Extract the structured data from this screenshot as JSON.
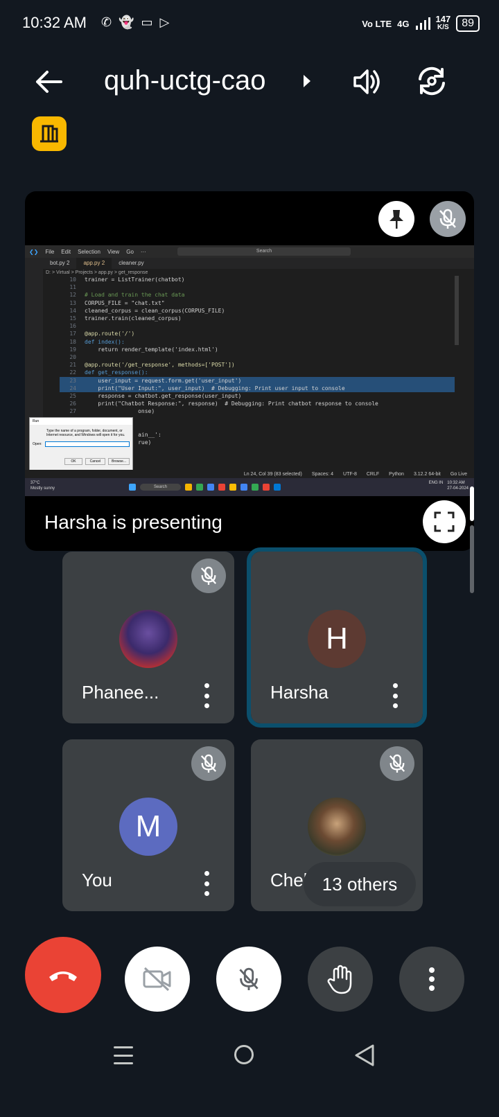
{
  "status_bar": {
    "time": "10:32 AM",
    "network": "Vo LTE",
    "signal": "4G",
    "speed_value": "147",
    "speed_unit": "K/S",
    "battery": "89",
    "notification_icons": [
      "whatsapp-icon",
      "snapchat-icon",
      "video-icon",
      "play-store-icon"
    ]
  },
  "header": {
    "meeting_code": "quh-uctg-cao",
    "icons": [
      "back-arrow-icon",
      "chevron-right-icon",
      "speaker-icon",
      "switch-camera-icon",
      "door-icon"
    ]
  },
  "presentation": {
    "presenter_text": "Harsha is presenting",
    "icons": [
      "pin-icon",
      "mic-off-icon",
      "fullscreen-icon"
    ],
    "shared_screen": {
      "menu": [
        "File",
        "Edit",
        "Selection",
        "View",
        "Go",
        "···"
      ],
      "search_placeholder": "Search",
      "tabs": [
        {
          "label": "bot.py",
          "badge": "2"
        },
        {
          "label": "app.py",
          "badge": "2"
        },
        {
          "label": "cleaner.py",
          "badge": ""
        }
      ],
      "breadcrumb": "D: > Virtual > Projects > app.py > get_response",
      "code_lines": [
        {
          "n": "10",
          "text": "trainer = ListTrainer(chatbot)"
        },
        {
          "n": "11",
          "text": ""
        },
        {
          "n": "12",
          "text": "# Load and train the chat data"
        },
        {
          "n": "13",
          "text": "CORPUS_FILE = \"chat.txt\""
        },
        {
          "n": "14",
          "text": "cleaned_corpus = clean_corpus(CORPUS_FILE)"
        },
        {
          "n": "15",
          "text": "trainer.train(cleaned_corpus)"
        },
        {
          "n": "16",
          "text": ""
        },
        {
          "n": "17",
          "text": "@app.route('/')"
        },
        {
          "n": "18",
          "text": "def index():"
        },
        {
          "n": "19",
          "text": "    return render_template('index.html')"
        },
        {
          "n": "20",
          "text": ""
        },
        {
          "n": "21",
          "text": "@app.route('/get_response', methods=['POST'])"
        },
        {
          "n": "22",
          "text": "def get_response():"
        },
        {
          "n": "23",
          "text": "    user_input = request.form.get('user_input')"
        },
        {
          "n": "24",
          "text": "    print(\"User Input:\", user_input)  # Debugging: Print user input to console"
        },
        {
          "n": "25",
          "text": "    response = chatbot.get_response(user_input)"
        },
        {
          "n": "26",
          "text": "    print(\"Chatbot Response:\", response)  # Debugging: Print chatbot response to console"
        },
        {
          "n": "27",
          "text": "                onse)"
        },
        {
          "n": "28",
          "text": ""
        },
        {
          "n": "29",
          "text": ""
        },
        {
          "n": "30",
          "text": "                ain__':"
        },
        {
          "n": "31",
          "text": "                rue)"
        }
      ],
      "run_dialog": {
        "title": "Run",
        "description": "Type the name of a program, folder, document, or Internet resource, and Windows will open it for you.",
        "open_label": "Open:",
        "buttons": [
          "OK",
          "Cancel",
          "Browse..."
        ]
      },
      "status_items": [
        "Ln 24, Col 39 (83 selected)",
        "Spaces: 4",
        "UTF-8",
        "CRLF",
        "Python",
        "3.12.2 64-bit",
        "Go Live"
      ],
      "taskbar": {
        "weather_temp": "37°C",
        "weather_text": "Mostly sunny",
        "search": "Search",
        "lang": "ENG IN",
        "clock_time": "10:32 AM",
        "clock_date": "27-04-2024"
      }
    }
  },
  "participants": [
    {
      "name": "Phanee...",
      "avatar_type": "photo",
      "initial": "",
      "muted": true,
      "active": false
    },
    {
      "name": "Harsha",
      "avatar_type": "initial",
      "initial": "H",
      "avatar_color": "#5d3a32",
      "muted": false,
      "active": true
    },
    {
      "name": "You",
      "avatar_type": "initial",
      "initial": "M",
      "avatar_color": "#5c6bc0",
      "muted": true,
      "active": false
    },
    {
      "name": "Chella",
      "avatar_type": "photo",
      "initial": "",
      "muted": true,
      "active": false
    }
  ],
  "others_pill": "13 others",
  "controls": {
    "icons": [
      "end-call-icon",
      "camera-off-icon",
      "mic-off-icon",
      "raise-hand-icon",
      "more-options-icon"
    ],
    "colors": {
      "end_call": "#ea4335",
      "active_speaker_outline": "#0b4f6c",
      "door_badge": "#f9b800"
    }
  },
  "nav_bar": {
    "icons": [
      "recent-apps-icon",
      "home-icon",
      "back-icon"
    ]
  }
}
